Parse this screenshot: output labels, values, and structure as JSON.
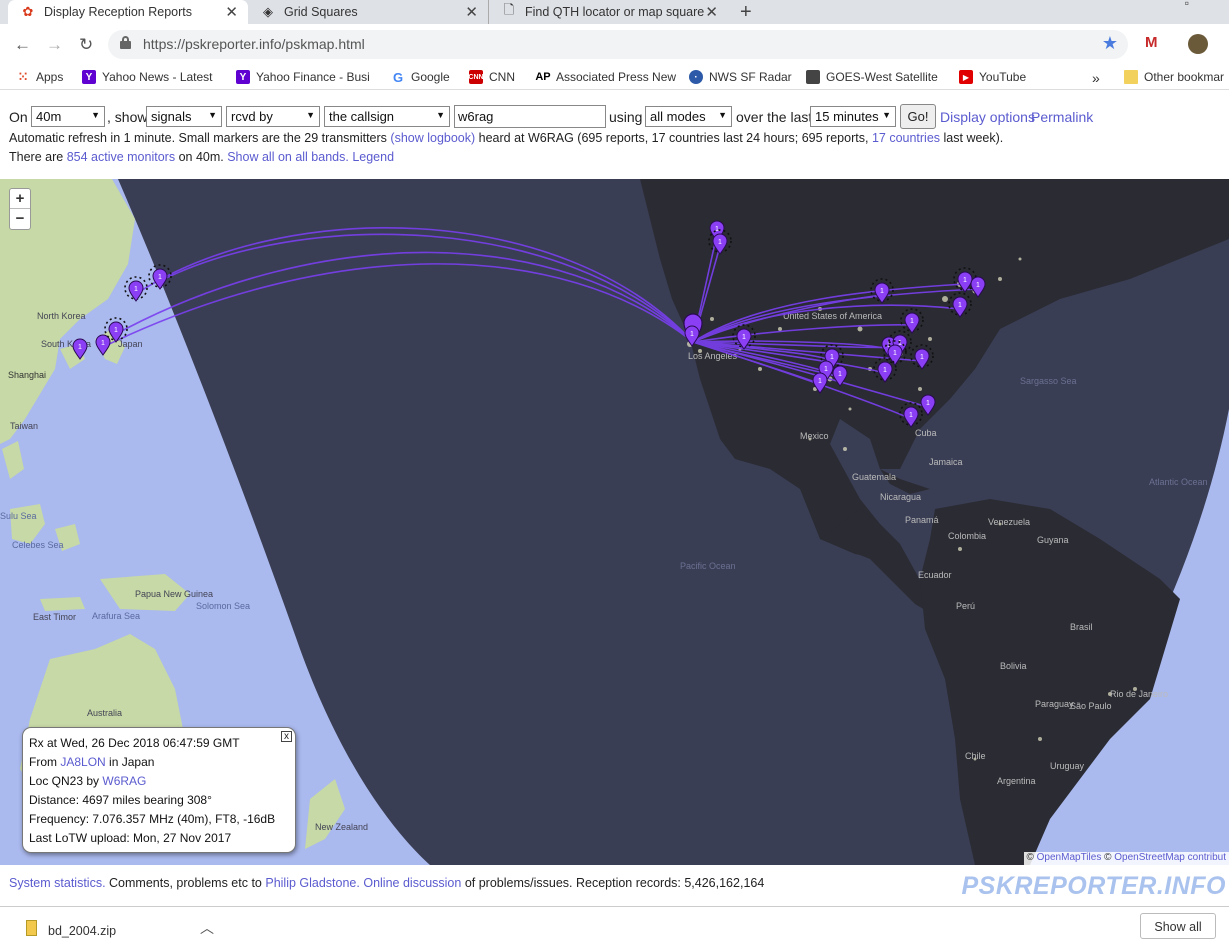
{
  "browser": {
    "tabs": [
      {
        "title": "Display Reception Reports",
        "icon": "pskreporter-icon",
        "active": true
      },
      {
        "title": "Grid Squares",
        "icon": "grid-squares-icon",
        "active": false
      },
      {
        "title": "Find QTH locator or map square",
        "icon": "document-icon",
        "active": false
      }
    ],
    "url": "https://pskreporter.info/pskmap.html",
    "bookmarks": [
      {
        "label": "Apps",
        "icon": "apps-grid-icon"
      },
      {
        "label": "Yahoo News - Latest",
        "icon": "yahoo-icon"
      },
      {
        "label": "Yahoo Finance - Busi",
        "icon": "yahoo-icon"
      },
      {
        "label": "Google",
        "icon": "google-icon"
      },
      {
        "label": "CNN",
        "icon": "cnn-icon"
      },
      {
        "label": "Associated Press New",
        "icon": "ap-icon"
      },
      {
        "label": "NWS SF Radar",
        "icon": "nws-icon"
      },
      {
        "label": "GOES-West Satellite",
        "icon": "satellite-icon"
      },
      {
        "label": "YouTube",
        "icon": "youtube-icon"
      },
      {
        "label": "Other bookmar",
        "icon": "folder-icon"
      }
    ],
    "bookmarks_more": "»"
  },
  "controls": {
    "on_label": "On",
    "band": "40m",
    "show_label": ", show",
    "show": "signals",
    "direction": "rcvd by",
    "target": "the callsign",
    "callsign": "w6rag",
    "using_label": "using",
    "mode": "all modes",
    "over_label": "over the last",
    "period": "15 minutes",
    "go": "Go!",
    "display_options": "Display options",
    "permalink": "Permalink"
  },
  "status": {
    "line1_a": "Automatic refresh in 1 minute. Small markers are the 29 transmitters",
    "line1_link1": "(show logbook)",
    "line1_b": "heard at W6RAG (695 reports, 17 countries last 24 hours; 695 reports,",
    "line1_link2": "17 countries",
    "line1_c": "last week).",
    "line2_a": "There are",
    "line2_link1": "854 active monitors",
    "line2_b": "on 40m.",
    "line2_link2": "Show all on all bands.",
    "line2_link3": "Legend"
  },
  "map": {
    "zoom_in": "+",
    "zoom_out": "−",
    "labels": [
      "North Korea",
      "South Korea",
      "Japan",
      "Shanghai",
      "Taiwan",
      "Sulu Sea",
      "Celebes Sea",
      "Papua New Guinea",
      "Solomon Sea",
      "East Timor",
      "Arafura Sea",
      "Australia",
      "New Zealand",
      "Los Angeles",
      "United States of America",
      "Mexico",
      "Cuba",
      "Jamaica",
      "Guatemala",
      "Nicaragua",
      "Panamá",
      "Venezuela",
      "Colombia",
      "Guyana",
      "Ecuador",
      "Perú",
      "Brasil",
      "Bolivia",
      "Paraguay",
      "Chile",
      "Argentina",
      "Uruguay",
      "São Paulo",
      "Rio de Janeiro",
      "Pacific Ocean",
      "Sargasso Sea",
      "Atlantic Ocean"
    ],
    "attribution_prefix": "©",
    "attribution_link1": "OpenMapTiles",
    "attribution_link2": "OpenStreetMap contribut"
  },
  "popup": {
    "rx": "Rx at Wed, 26 Dec 2018 06:47:59 GMT",
    "from_label": "From",
    "from_call": "JA8LON",
    "from_country": "in Japan",
    "loc_label": "Loc QN23 by",
    "loc_call": "W6RAG",
    "distance": "Distance: 4697 miles bearing 308°",
    "frequency": "Frequency: 7.076.357 MHz (40m), FT8, -16dB",
    "lotw": "Last LoTW upload: Mon, 27 Nov 2017",
    "close": "x"
  },
  "footer": {
    "system_statistics": "System statistics.",
    "comments": "Comments, problems etc to",
    "author": "Philip Gladstone.",
    "online_discussion": "Online discussion",
    "records": "of problems/issues. Reception records: 5,426,162,164",
    "brand": "PSKREPORTER.INFO"
  },
  "download": {
    "file": "bd_2004.zip",
    "show_all": "Show all"
  },
  "colors": {
    "link": "#5b5bd0",
    "path": "#7a3ff0",
    "marker": "#8b3ff5",
    "night": "#3a3e54",
    "day_ocean": "#a8b8f0"
  }
}
